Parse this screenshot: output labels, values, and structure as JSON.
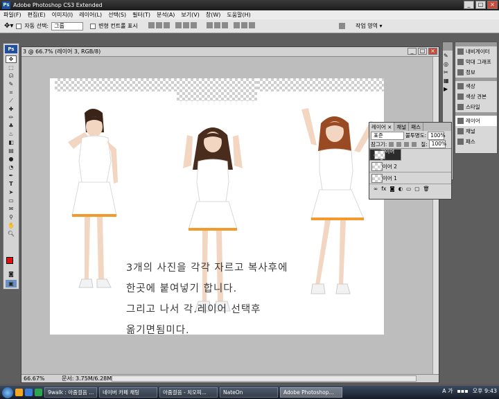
{
  "app": {
    "title": "Adobe Photoshop CS3 Extended",
    "badge": "Ps"
  },
  "menu": [
    "파일(F)",
    "편집(E)",
    "이미지(I)",
    "레이어(L)",
    "선택(S)",
    "필터(T)",
    "분석(A)",
    "보기(V)",
    "창(W)",
    "도움말(H)"
  ],
  "options": {
    "auto_select": "자동 선택:",
    "auto_select_value": "그룹",
    "transform": "변형 컨트롤 표시",
    "workspace": "작업 영역 ▾"
  },
  "document": {
    "title": "3 @ 66.7% (레이어 3, RGB/8)",
    "zoom": "66.67%",
    "doc_size": "문서: 3.75M/6.28M"
  },
  "canvas_text": [
    "3개의 사진을 각각 자르고 복사후에",
    "한곳에 붙여넣기 합니다.",
    "그리고 나서 각.레이어 선택후",
    "옮기면됨미다."
  ],
  "layers_panel": {
    "tabs": [
      "레이어 ×",
      "채널",
      "패스"
    ],
    "blend": "표준",
    "opacity_label": "불투명도:",
    "opacity": "100%",
    "lock_label": "잠그기:",
    "fill_label": "칠:",
    "fill": "100%",
    "layers": [
      {
        "name": "레이어 3",
        "selected": true
      },
      {
        "name": "레이어 2",
        "selected": false
      },
      {
        "name": "레이어 1",
        "selected": false
      }
    ]
  },
  "dock": {
    "group1": [
      "내비게이터",
      "막대 그래프",
      "정보"
    ],
    "group2": [
      "색상",
      "색상 견본",
      "스타일"
    ],
    "group3": [
      "레이어",
      "채널",
      "패스"
    ]
  },
  "taskbar": {
    "items": [
      "9walk : 아줌걸음 ...",
      "네이버 카페 채팅",
      "아줌걸음 - 치오피...",
      "NateOn",
      "Adobe Photoshop..."
    ],
    "ime": "A 가",
    "time": "오후 9:43"
  },
  "colors": {
    "foreground": "#e01010",
    "background": "#ffffff",
    "selected_layer": "#2b2b2b"
  }
}
